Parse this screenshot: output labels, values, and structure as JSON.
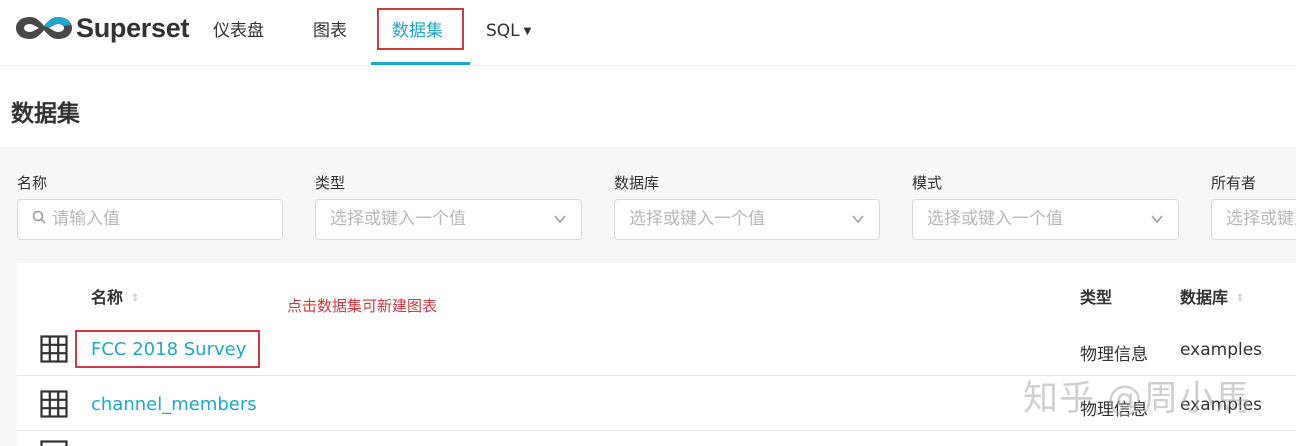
{
  "app": {
    "brand": "Superset",
    "brand_color": "#484848",
    "accent_color": "#20a7c9"
  },
  "nav": {
    "items": [
      {
        "label": "仪表盘"
      },
      {
        "label": "图表"
      },
      {
        "label": "数据集",
        "active": true
      },
      {
        "label": "SQL",
        "dropdown": true
      }
    ]
  },
  "page": {
    "title": "数据集"
  },
  "filters": [
    {
      "label": "名称",
      "placeholder": "请输入值",
      "icon": "search-icon"
    },
    {
      "label": "类型",
      "placeholder": "选择或键入一个值",
      "icon": "chevron-down-icon"
    },
    {
      "label": "数据库",
      "placeholder": "选择或键入一个值",
      "icon": "chevron-down-icon"
    },
    {
      "label": "模式",
      "placeholder": "选择或键入一个值",
      "icon": "chevron-down-icon"
    },
    {
      "label": "所有者",
      "placeholder": "选择或键入一个值"
    }
  ],
  "table": {
    "columns": [
      {
        "label": "名称",
        "sortable": true
      },
      {
        "label": "类型",
        "sortable": false
      },
      {
        "label": "数据库",
        "sortable": true
      }
    ],
    "rows": [
      {
        "name": "FCC 2018 Survey",
        "kind": "物理信息",
        "database": "examples"
      },
      {
        "name": "channel_members",
        "kind": "物理信息",
        "database": "examples"
      }
    ]
  },
  "annotation": {
    "note": "点击数据集可新建图表",
    "color": "#cf3b42"
  },
  "watermark": "知乎 @周小馬"
}
